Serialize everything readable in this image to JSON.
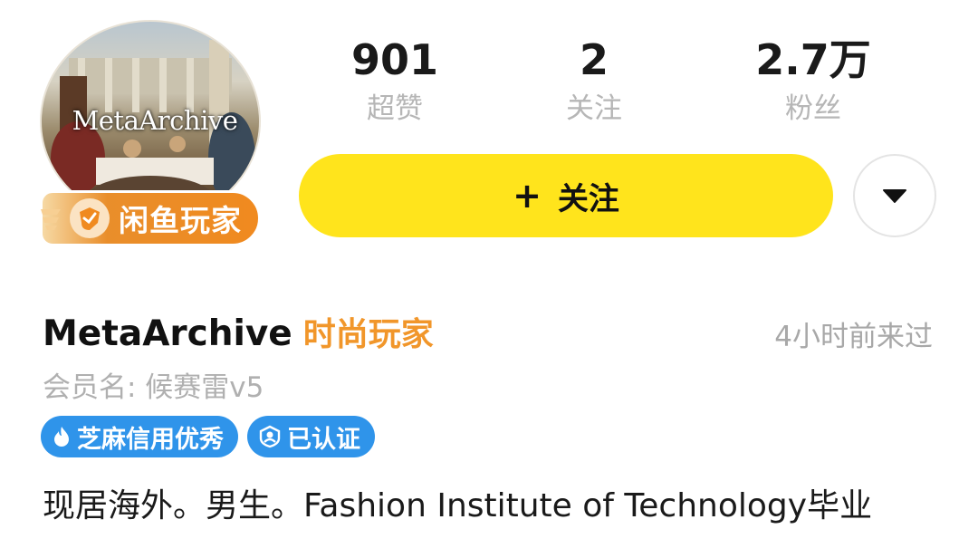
{
  "profile": {
    "avatar_logo_text": "MetaArchive",
    "player_badge": "闲鱼玩家",
    "name": "MetaArchive",
    "title_tag": "时尚玩家",
    "last_seen": "4小时前来过",
    "member_name": "会员名: 候赛雷v5",
    "bio": "现居海外。男生。Fashion Institute of Technology毕业"
  },
  "stats": [
    {
      "value": "901",
      "label": "超赞"
    },
    {
      "value": "2",
      "label": "关注"
    },
    {
      "value": "2.7万",
      "label": "粉丝"
    }
  ],
  "actions": {
    "follow_icon": "+",
    "follow_label": "关注",
    "more_icon": "caret-down-icon"
  },
  "tags": [
    {
      "icon": "flame-icon",
      "label": "芝麻信用优秀"
    },
    {
      "icon": "verified-user-icon",
      "label": "已认证"
    }
  ],
  "colors": {
    "accent_yellow": "#ffe41c",
    "title_orange": "#f1962a",
    "tag_blue": "#2f94ea",
    "muted_gray": "#b0b0b0"
  }
}
